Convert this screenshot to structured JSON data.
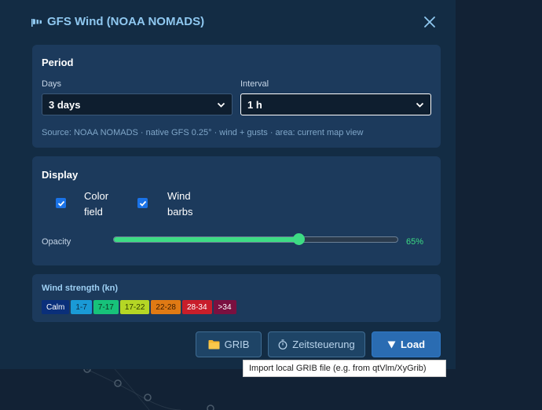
{
  "dialog": {
    "title": "GFS Wind (NOAA NOMADS)",
    "title_icon": "windsock-icon",
    "close_icon": "close-icon"
  },
  "period": {
    "heading": "Period",
    "days_label": "Days",
    "days_value": "3 days",
    "interval_label": "Interval",
    "interval_value": "1 h",
    "source_note": "Source: NOAA NOMADS · native GFS 0.25° · wind + gusts · area: current map view"
  },
  "display": {
    "heading": "Display",
    "color_field_label_line1": "Color",
    "color_field_label_line2": "field",
    "color_field_checked": true,
    "wind_barbs_label_line1": "Wind",
    "wind_barbs_label_line2": "barbs",
    "wind_barbs_checked": true,
    "opacity_label": "Opacity",
    "opacity_fraction": 0.65,
    "opacity_value": "65%"
  },
  "wind_strength": {
    "heading": "Wind strength (kn)",
    "chips": [
      {
        "label": "Calm",
        "bg": "#0a2f7a",
        "fg": "#ffffff"
      },
      {
        "label": "1-7",
        "bg": "#1a9ad6",
        "fg": "#0b2a44"
      },
      {
        "label": "7-17",
        "bg": "#17c27a",
        "fg": "#0b3320"
      },
      {
        "label": "17-22",
        "bg": "#b5d625",
        "fg": "#2e3a00"
      },
      {
        "label": "22-28",
        "bg": "#e07a14",
        "fg": "#3a1c00"
      },
      {
        "label": "28-34",
        "bg": "#c81e2a",
        "fg": "#ffffff"
      },
      {
        "label": ">34",
        "bg": "#7a1040",
        "fg": "#ffffff"
      }
    ]
  },
  "buttons": {
    "grib_label": "GRIB",
    "grib_icon": "folder-icon",
    "timer_label": "Zeitsteuerung",
    "timer_icon": "stopwatch-icon",
    "load_label": "Load",
    "load_icon": "down-triangle-icon"
  },
  "tooltip": {
    "text": "Import local GRIB file (e.g. from qtVlm/XyGrib)"
  },
  "colors": {
    "accent_green": "#3ddc84",
    "title_blue": "#8fc8f0",
    "primary_button": "#2a6cb2"
  }
}
